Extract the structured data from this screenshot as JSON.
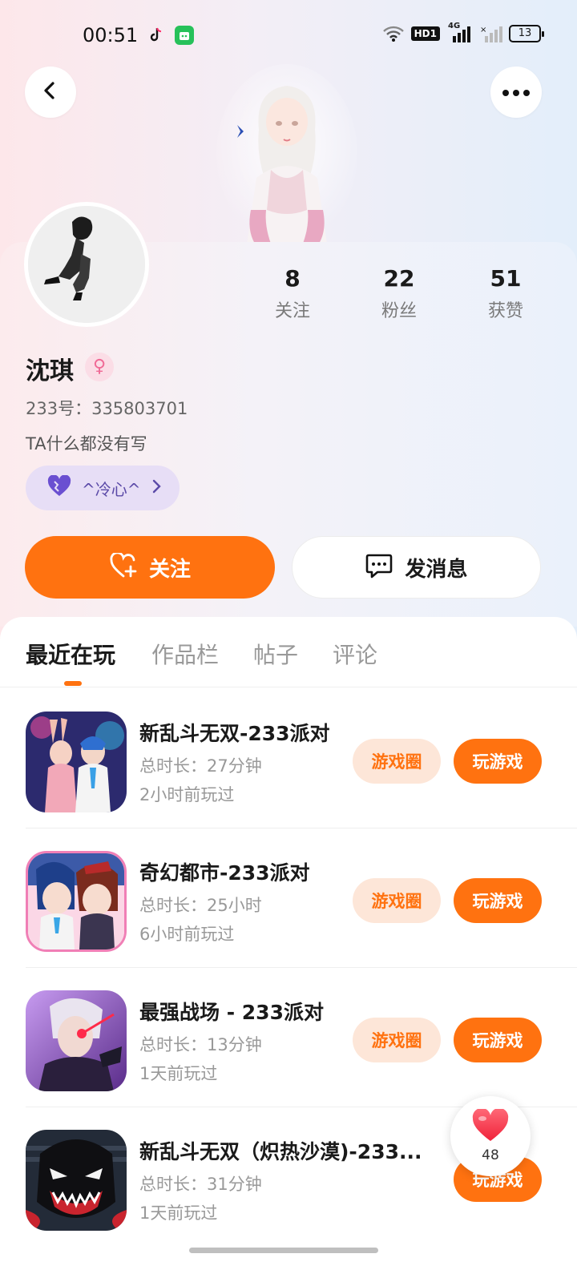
{
  "status_bar": {
    "time": "00:51",
    "network_badge": "HD1",
    "network_type": "4G",
    "battery": "13"
  },
  "profile": {
    "name": "沈琪",
    "gender_symbol": "♀",
    "uid": "233号：335803701",
    "bio": "TA什么都没有写",
    "heart_tag": "^冷心^",
    "stats": [
      {
        "value": "8",
        "label": "关注"
      },
      {
        "value": "22",
        "label": "粉丝"
      },
      {
        "value": "51",
        "label": "获赞"
      }
    ]
  },
  "actions": {
    "follow_label": "关注",
    "message_label": "发消息"
  },
  "tabs": [
    {
      "label": "最近在玩",
      "active": true
    },
    {
      "label": "作品栏",
      "active": false
    },
    {
      "label": "帖子",
      "active": false
    },
    {
      "label": "评论",
      "active": false
    }
  ],
  "games": [
    {
      "title": "新乱斗无双-233派对",
      "duration": "总时长：27分钟",
      "last_played": "2小时前玩过",
      "circle_label": "游戏圈",
      "play_label": "玩游戏"
    },
    {
      "title": "奇幻都市-233派对",
      "duration": "总时长：25小时",
      "last_played": "6小时前玩过",
      "circle_label": "游戏圈",
      "play_label": "玩游戏"
    },
    {
      "title": "最强战场 - 233派对",
      "duration": "总时长：13分钟",
      "last_played": "1天前玩过",
      "circle_label": "游戏圈",
      "play_label": "玩游戏"
    },
    {
      "title": "新乱斗无双（炽热沙漠)-233...",
      "duration": "总时长：31分钟",
      "last_played": "1天前玩过",
      "circle_label": "",
      "play_label": "玩游戏"
    }
  ],
  "like_fab": {
    "count": "48"
  },
  "colors": {
    "accent": "#ff7210",
    "accent_soft": "#fde6d8",
    "tag_bg": "#e7def6",
    "tag_text": "#5b4aa8",
    "heart": "#ff3b4e"
  }
}
